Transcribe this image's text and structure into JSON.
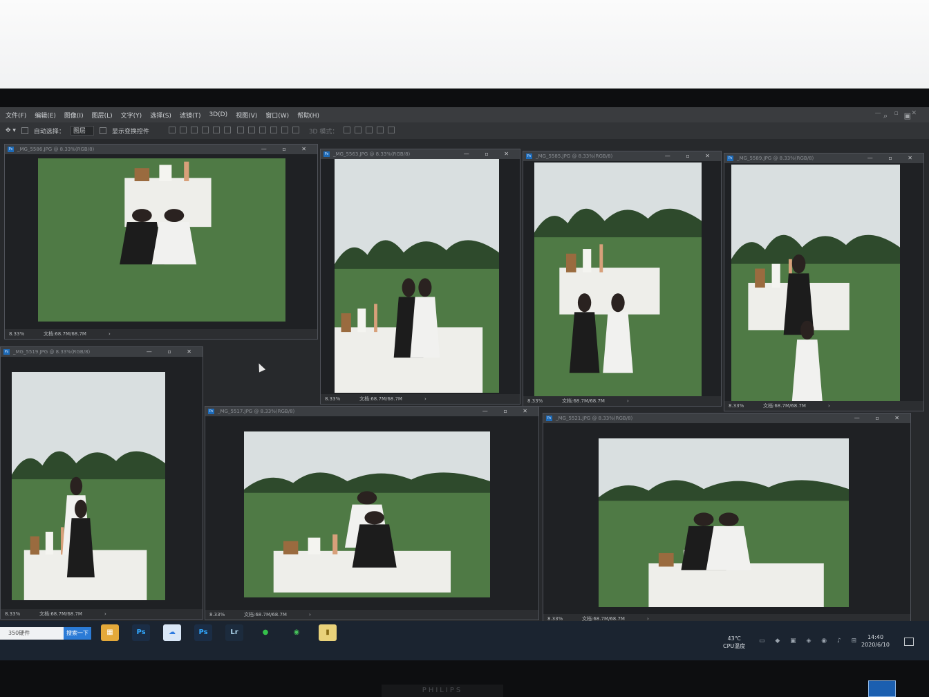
{
  "menubar": {
    "items": [
      "文件(F)",
      "编辑(E)",
      "图像(I)",
      "图层(L)",
      "文字(Y)",
      "选择(S)",
      "滤镜(T)",
      "3D(D)",
      "视图(V)",
      "窗口(W)",
      "帮助(H)"
    ]
  },
  "options": {
    "auto_select_label": "自动选择：",
    "layer_value": "图层",
    "transform_label": "显示变换控件",
    "mode_3d_label": "3D 模式："
  },
  "documents": [
    {
      "title": "_MG_5586.JPG @ 8.33%(RGB/8)",
      "zoom": "8.33%",
      "info": "文档:68.7M/68.7M",
      "scene": "couple-sitting"
    },
    {
      "title": "_MG_5563.JPG @ 8.33%(RGB/8)",
      "zoom": "8.33%",
      "info": "文档:68.7M/68.7M",
      "scene": "couple-walking"
    },
    {
      "title": "_MG_5585.JPG @ 8.33%(RGB/8)",
      "zoom": "8.33%",
      "info": "文档:68.7M/68.7M",
      "scene": "couple-sitting-table"
    },
    {
      "title": "_MG_5589.JPG @ 8.33%(RGB/8)",
      "zoom": "8.33%",
      "info": "文档:68.7M/68.7M",
      "scene": "bride-waving"
    },
    {
      "title": "_MG_5519.JPG @ 8.33%(RGB/8)",
      "zoom": "8.33%",
      "info": "文档:68.7M/68.7M",
      "scene": "lift"
    },
    {
      "title": "_MG_5517.JPG @ 8.33%(RGB/8)",
      "zoom": "8.33%",
      "info": "文档:68.7M/68.7M",
      "scene": "veil"
    },
    {
      "title": "_MG_5521.JPG @ 8.33%(RGB/8)",
      "zoom": "8.33%",
      "info": "文档:68.7M/68.7M",
      "scene": "carry"
    }
  ],
  "taskbar": {
    "search_text": "350硬件",
    "search_button": "搜索一下",
    "apps": [
      {
        "icon": "gallery-app-icon",
        "label": ""
      },
      {
        "icon": "photoshop-icon",
        "label": "Ps"
      },
      {
        "icon": "cloud-app-icon",
        "label": ""
      },
      {
        "icon": "photoshop-icon",
        "label": "Ps"
      },
      {
        "icon": "lightroom-icon",
        "label": "Lr"
      },
      {
        "icon": "wechat-icon",
        "label": ""
      },
      {
        "icon": "360-icon",
        "label": ""
      },
      {
        "icon": "folder-icon",
        "label": ""
      }
    ],
    "temperature": "43℃",
    "temperature_label": "CPU温度",
    "time": "14:40",
    "date": "2020/6/10"
  },
  "monitor": {
    "brand": "PHILIPS"
  },
  "colors": {
    "ps_blue": "#1e6bb8",
    "lr_bg": "#1c2b3d",
    "search_blue": "#2b7bd6",
    "grass": "#4f7a45"
  }
}
